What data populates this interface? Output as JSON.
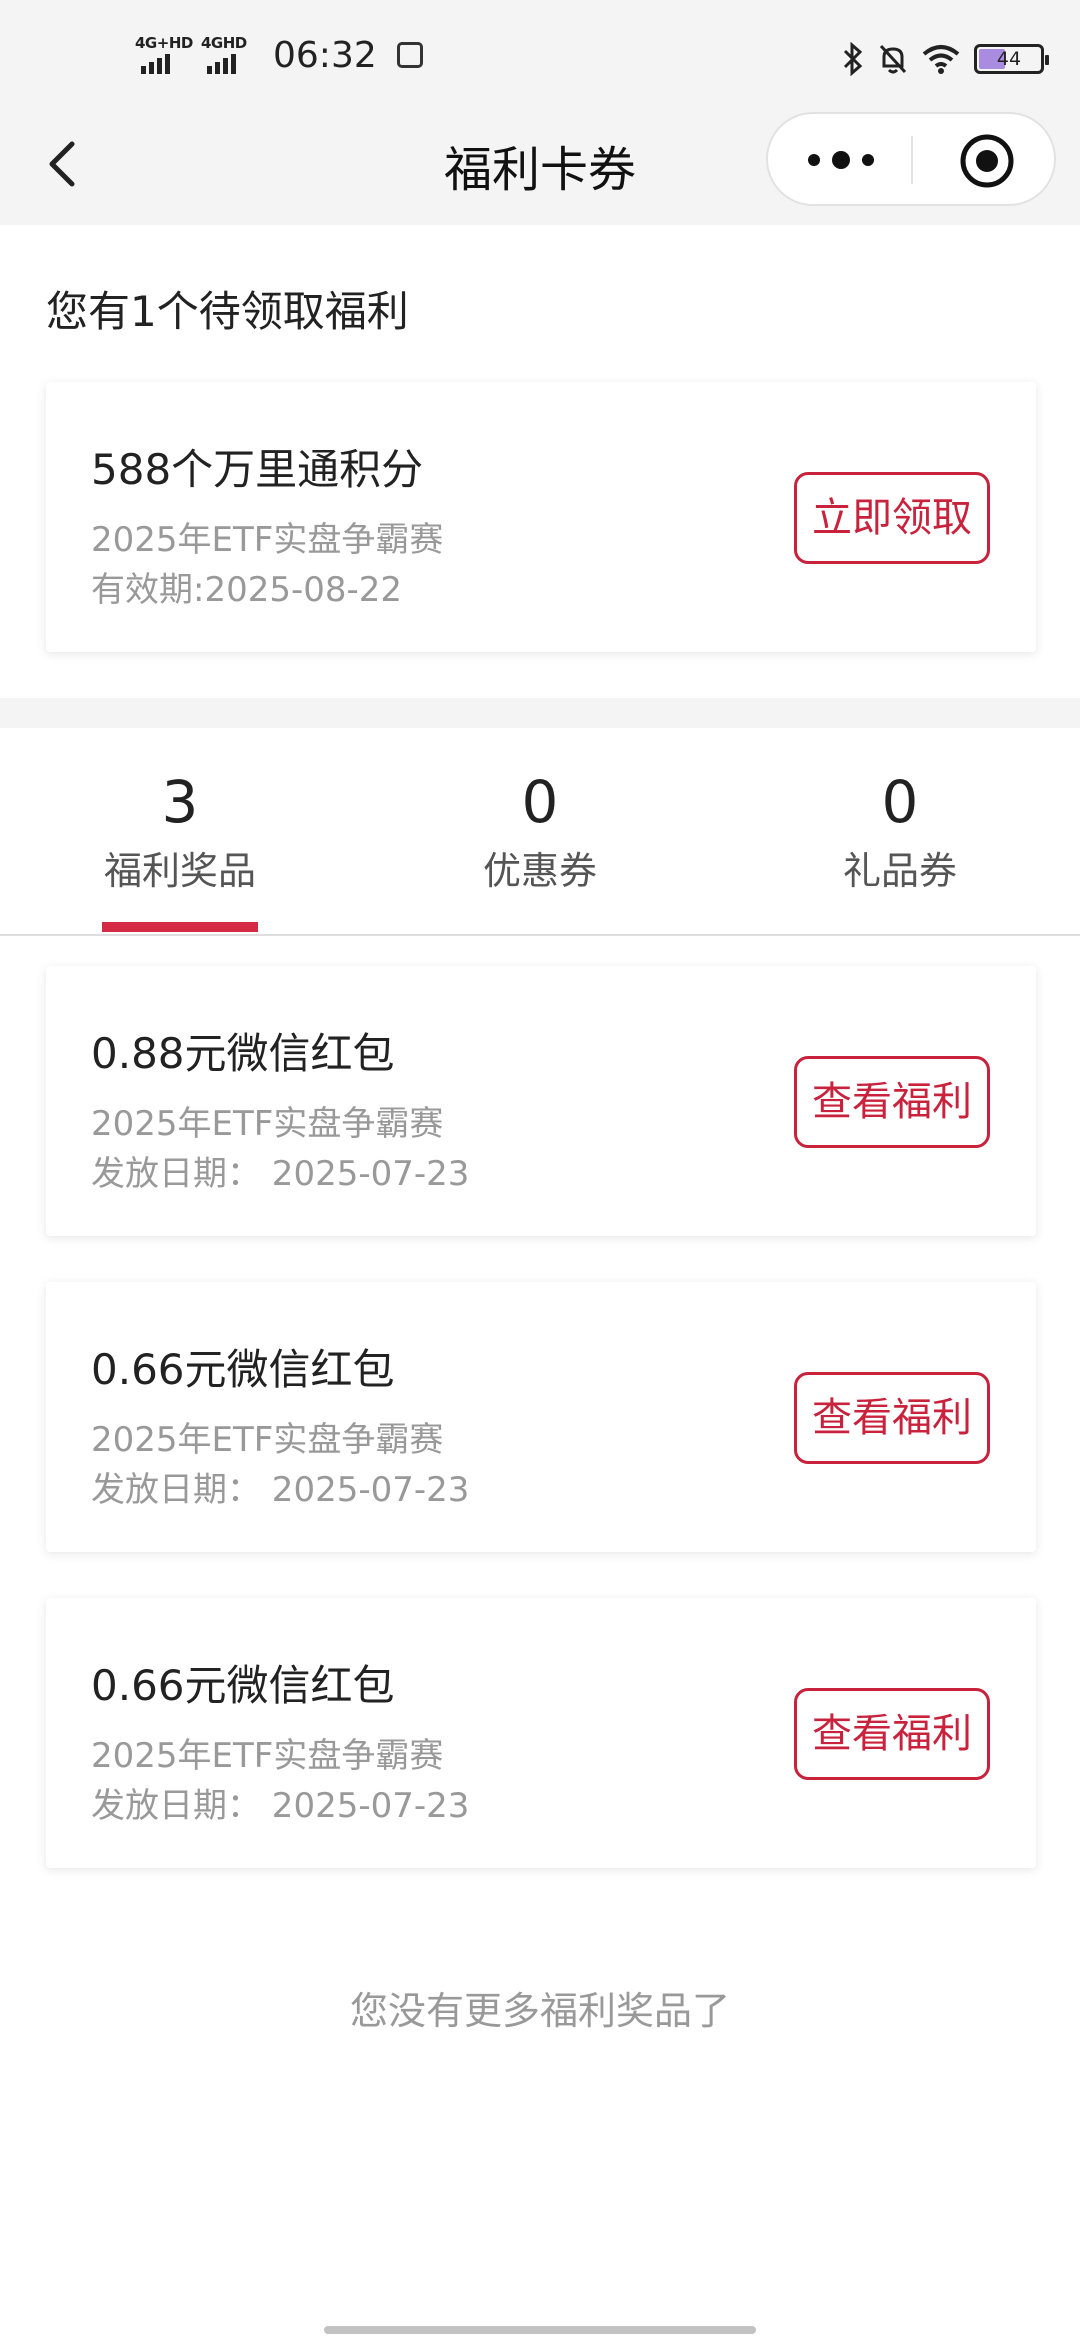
{
  "status_bar": {
    "net1_label": "4G+HD",
    "net2_label": "4GHD",
    "time": "06:32",
    "battery": "44",
    "battery_level": 0.44
  },
  "nav": {
    "title": "福利卡券"
  },
  "pending": {
    "label": "您有1个待领取福利",
    "card": {
      "title": "588个万里通积分",
      "subtitle": "2025年ETF实盘争霸赛",
      "validity": "有效期:2025-08-22",
      "button": "立即领取"
    }
  },
  "tabs": [
    {
      "count": "3",
      "label": "福利奖品",
      "active": true
    },
    {
      "count": "0",
      "label": "优惠券",
      "active": false
    },
    {
      "count": "0",
      "label": "礼品券",
      "active": false
    }
  ],
  "prizes": [
    {
      "title": "0.88元微信红包",
      "subtitle": "2025年ETF实盘争霸赛",
      "date": "发放日期：  2025-07-23",
      "button": "查看福利"
    },
    {
      "title": "0.66元微信红包",
      "subtitle": "2025年ETF实盘争霸赛",
      "date": "发放日期：  2025-07-23",
      "button": "查看福利"
    },
    {
      "title": "0.66元微信红包",
      "subtitle": "2025年ETF实盘争霸赛",
      "date": "发放日期：  2025-07-23",
      "button": "查看福利"
    }
  ],
  "end_text": "您没有更多福利奖品了",
  "colors": {
    "accent": "#c8223c",
    "background_grey": "#f4f4f4"
  }
}
